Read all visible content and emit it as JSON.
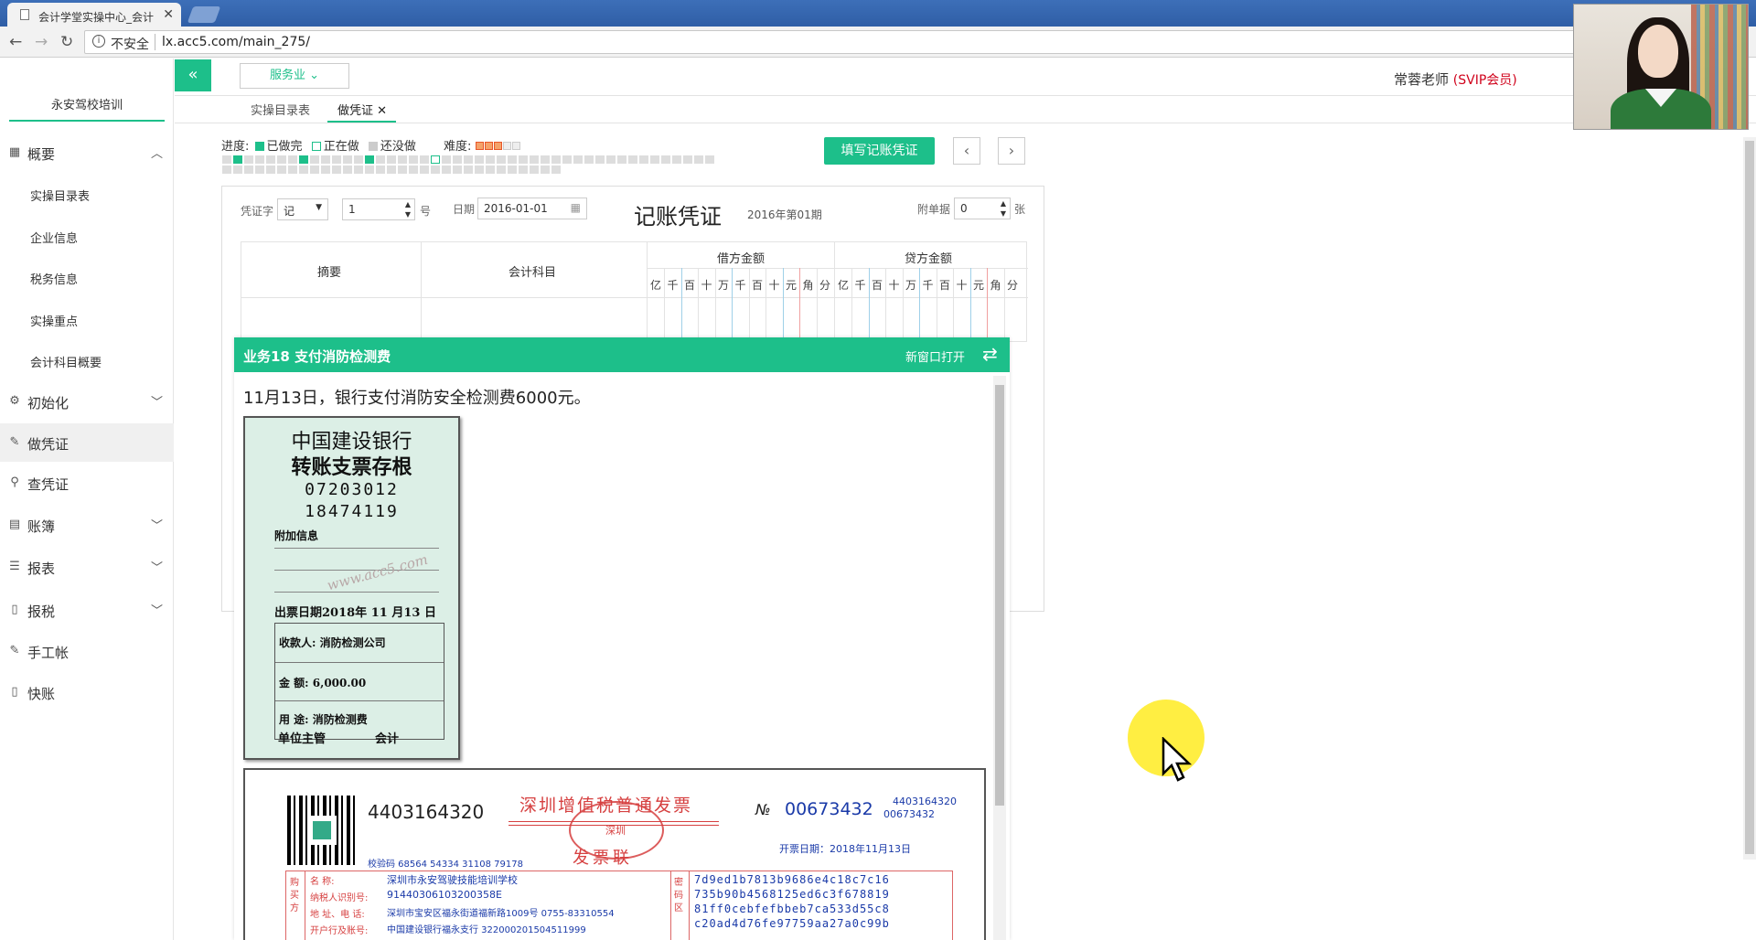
{
  "browser": {
    "tab_title": "会计学堂实操中心_会计",
    "security": "不安全",
    "url": "lx.acc5.com/main_275/"
  },
  "sidebar": {
    "school": "永安驾校培训",
    "overview": "概要",
    "subitems": [
      "实操目录表",
      "企业信息",
      "税务信息",
      "实操重点",
      "会计科目概要"
    ],
    "init": "初始化",
    "make_voucher": "做凭证",
    "query_voucher": "查凭证",
    "ledger": "账簿",
    "report": "报表",
    "tax": "报税",
    "manual": "手工帐",
    "quick": "快账"
  },
  "toolbar": {
    "collapse": "«",
    "industry": "服务业",
    "teacher": "常蓉老师",
    "vip": "(SVIP会员)"
  },
  "tabs": {
    "catalog": "实操目录表",
    "voucher": "做凭证"
  },
  "progress": {
    "label": "进度:",
    "done": "已做完",
    "doing": "正在做",
    "todo": "还没做",
    "difficulty": "难度:",
    "difficulty_stars": 3
  },
  "actions": {
    "fill": "填写记账凭证",
    "prev": "‹",
    "next": "›"
  },
  "voucher": {
    "type_label": "凭证字",
    "type_value": "记",
    "number_value": "1",
    "number_unit": "号",
    "date_label": "日期",
    "date_value": "2016-01-01",
    "title": "记账凭证",
    "period": "2016年第01期",
    "attach_label": "附单据",
    "attach_value": "0",
    "attach_unit": "张",
    "col_summary": "摘要",
    "col_account": "会计科目",
    "col_debit": "借方金额",
    "col_credit": "贷方金额",
    "digits": [
      "亿",
      "千",
      "百",
      "十",
      "万",
      "千",
      "百",
      "十",
      "元",
      "角",
      "分"
    ]
  },
  "business": {
    "title": "业务18 支付消防检测费",
    "open_new": "新窗口打开",
    "description": "11月13日，银行支付消防安全检测费6000元。"
  },
  "stub": {
    "bank": "中国建设银行",
    "name": "转账支票存根",
    "code1": "07203012",
    "code2": "18474119",
    "extra": "附加信息",
    "watermark": "www.acc5.com",
    "date": "出票日期2018年 11 月13 日",
    "payee": "收款人: 消防检测公司",
    "amount": "金   额: 6,000.00",
    "use": "用   途: 消防检测费",
    "supervisor": "单位主管",
    "accountant": "会计"
  },
  "invoice": {
    "code": "4403164320",
    "title": "深圳增值税普通发票",
    "no_label": "№",
    "number": "00673432",
    "code_small": "4403164320",
    "number_small": "00673432",
    "seal_text": "深圳",
    "copy": "发票联",
    "issue_date": "开票日期：2018年11月13日",
    "check_code": "校验码 68564 54334 31108 79178",
    "buyer_name_label": "名        称:",
    "buyer_name": "深圳市永安驾驶技能培训学校",
    "taxid_label": "纳税人识别号:",
    "taxid": "91440306103200358E",
    "addr_label": "地  址、电  话:",
    "addr": "深圳市宝安区福永街道福新路1009号 0755-83310554",
    "bank_label": "开户行及账号:",
    "bank": "中国建设银行福永支行 322000201504511999",
    "buyer_side": "购买方",
    "cipher_side": "密码区",
    "cipher": [
      "7d9ed1b7813b9686e4c18c7c16",
      "735b90b4568125ed6c3f678819",
      "81ff0cebfefbbeb7ca533d55c8",
      "c20ad4d76fe97759aa27a0c99b"
    ]
  },
  "colors": {
    "accent": "#1dbf8a",
    "vip": "#d0021b",
    "invoice_red": "#d64040",
    "invoice_blue": "#1a3aa8"
  }
}
